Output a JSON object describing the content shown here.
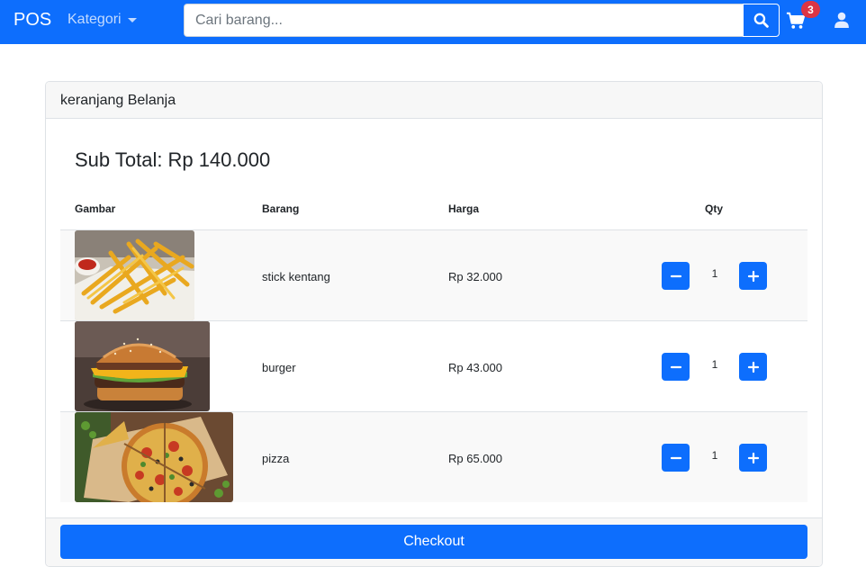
{
  "navbar": {
    "brand": "POS",
    "kategori_label": "Kategori",
    "search": {
      "placeholder": "Cari barang...",
      "value": ""
    },
    "cart_count": "3",
    "colors": {
      "primary": "#0d6efd",
      "badge": "#dc3545"
    }
  },
  "card": {
    "header": "keranjang Belanja",
    "subtotal_label": "Sub Total:",
    "subtotal_value": "Rp 140.000",
    "columns": [
      "Gambar",
      "Barang",
      "Harga",
      "Qty"
    ],
    "items": [
      {
        "name": "stick kentang",
        "price": "Rp 32.000",
        "qty": "1",
        "image": "fries-photo"
      },
      {
        "name": "burger",
        "price": "Rp 43.000",
        "qty": "1",
        "image": "burger-photo"
      },
      {
        "name": "pizza",
        "price": "Rp 65.000",
        "qty": "1",
        "image": "pizza-photo"
      }
    ],
    "checkout_label": "Checkout"
  }
}
